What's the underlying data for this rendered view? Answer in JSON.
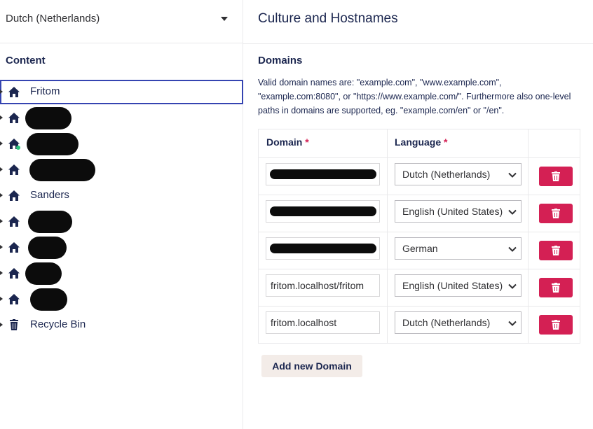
{
  "left": {
    "culture_select": {
      "value": "Dutch (Netherlands)"
    },
    "content_title": "Content",
    "tree": [
      {
        "label": "Fritom",
        "icon": "home-icon",
        "selected": true,
        "redacted": false
      },
      {
        "label": "",
        "icon": "home-icon",
        "redacted": true
      },
      {
        "label": "",
        "icon": "home-add-icon",
        "redacted": true
      },
      {
        "label": "",
        "icon": "home-icon",
        "redacted": true
      },
      {
        "label": "Sanders",
        "icon": "home-icon",
        "redacted": false
      },
      {
        "label": "",
        "icon": "home-icon",
        "redacted": true
      },
      {
        "label": "",
        "icon": "home-icon",
        "redacted": true
      },
      {
        "label": "",
        "icon": "home-icon",
        "redacted": true
      },
      {
        "label": "",
        "icon": "home-icon",
        "redacted": true
      },
      {
        "label": "Recycle Bin",
        "icon": "trash-icon",
        "redacted": false
      }
    ]
  },
  "right": {
    "title": "Culture and Hostnames",
    "domains_title": "Domains",
    "description": "Valid domain names are: \"example.com\", \"www.example.com\", \"example.com:8080\", or \"https://www.example.com/\". Furthermore also one-level paths in domains are supported, eg. \"example.com/en\" or \"/en\".",
    "table": {
      "col_domain": "Domain",
      "col_language": "Language",
      "required_mark": "*",
      "rows": [
        {
          "domain": "",
          "domain_redacted": true,
          "language": "Dutch (Netherlands)"
        },
        {
          "domain": "",
          "domain_redacted": true,
          "language": "English (United States)"
        },
        {
          "domain": "",
          "domain_redacted": true,
          "language": "German"
        },
        {
          "domain": "fritom.localhost/fritom",
          "domain_redacted": false,
          "language": "English (United States)"
        },
        {
          "domain": "fritom.localhost",
          "domain_redacted": false,
          "language": "Dutch (Netherlands)"
        }
      ]
    },
    "add_button": "Add new Domain"
  },
  "colors": {
    "accent": "#3544b1",
    "danger": "#d42054",
    "text": "#1b264f"
  }
}
